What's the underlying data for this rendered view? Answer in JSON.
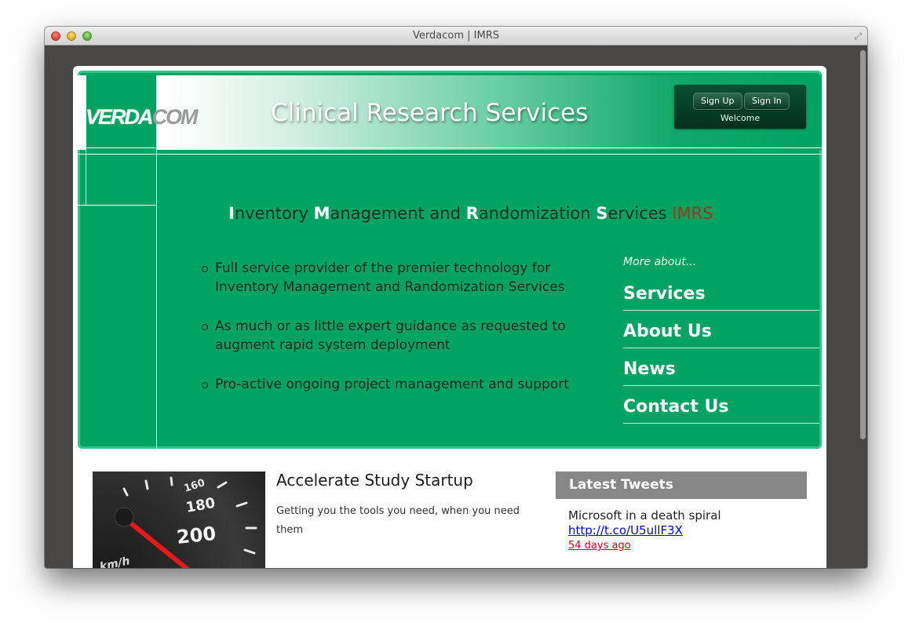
{
  "window": {
    "title": "Verdacom | IMRS"
  },
  "header": {
    "logo_part1": "VERDA",
    "logo_part2": "COM",
    "title": "Clinical Research Services",
    "auth": {
      "signup_label": "Sign Up",
      "signin_label": "Sign In",
      "welcome": "Welcome"
    }
  },
  "hero": {
    "subtitle": {
      "w1_initial": "I",
      "w1_rest": "nventory",
      "w2_initial": "M",
      "w2_rest": "anagement and",
      "w3_initial": "R",
      "w3_rest": "andomization",
      "w4_initial": "S",
      "w4_rest": "ervices",
      "acronym": "IMRS"
    },
    "bullets": [
      "Full service provider of the premier technology for Inventory Management and Randomization Services",
      "As much or as little expert guidance as requested to augment rapid system deployment",
      "Pro-active ongoing project management and support"
    ],
    "more_label": "More about...",
    "more_links": [
      "Services",
      "About Us",
      "News",
      "Contact Us"
    ]
  },
  "feature": {
    "title": "Accelerate Study Startup",
    "text": "Getting you the tools you need, when you need them",
    "gauge": {
      "t160": "160",
      "t180": "180",
      "t200": "200",
      "unit": "km/h"
    }
  },
  "tweets": {
    "heading": "Latest Tweets",
    "items": [
      {
        "text": "Microsoft in a death spiral",
        "link": "http://t.co/U5ullF3X",
        "time": "54 days ago"
      }
    ]
  },
  "colors": {
    "brand_green": "#00a362",
    "acronym_red": "#a6331b",
    "tweet_time_red": "#e0000f",
    "tweets_header_gray": "#878787"
  }
}
